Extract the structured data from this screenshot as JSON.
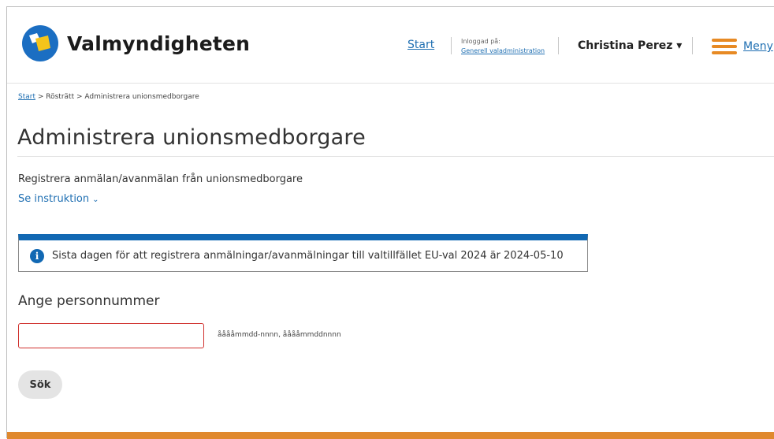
{
  "header": {
    "logo_text": "Valmyndigheten",
    "nav_start": "Start",
    "login_label": "Inloggad på:",
    "login_link": "Generell valadministration",
    "user_name": "Christina Perez ▾",
    "menu_label": "Meny"
  },
  "breadcrumb": {
    "start": "Start",
    "rest": " > Rösträtt > Administrera unionsmedborgare"
  },
  "page": {
    "title": "Administrera unionsmedborgare",
    "subtitle": "Registrera anmälan/avanmälan från unionsmedborgare",
    "instruction_link": "Se instruktion"
  },
  "notice": {
    "text": "Sista dagen för att registrera anmälningar/avanmälningar till valtillfället EU-val 2024 är 2024-05-10"
  },
  "form": {
    "label": "Ange personnummer",
    "value": "",
    "hint": "ååååmmdd-nnnn, ååååmmddnnnn",
    "search_button": "Sök"
  },
  "colors": {
    "accent_blue": "#1168b3",
    "link_blue": "#1f6fb2",
    "orange": "#e0892e",
    "error_red": "#d0312d"
  }
}
